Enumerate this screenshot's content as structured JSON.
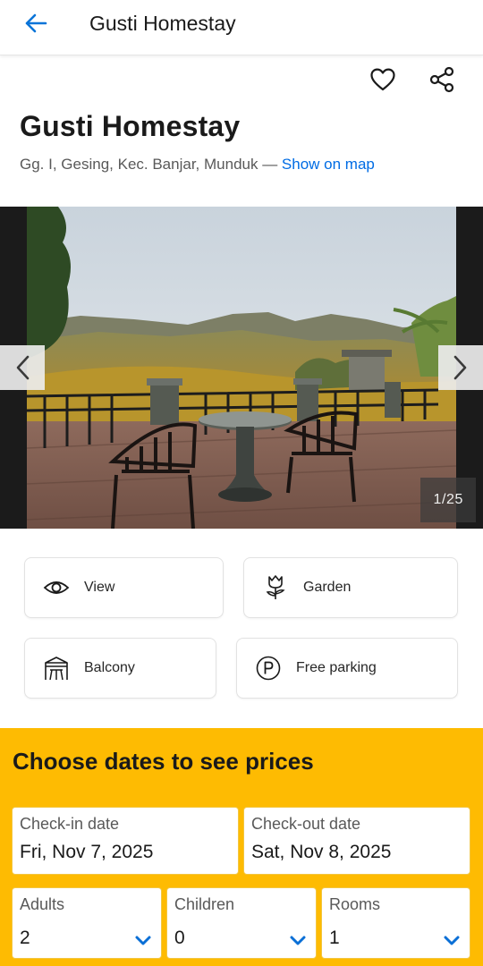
{
  "header": {
    "title": "Gusti Homestay",
    "back_icon": "arrow-left-icon"
  },
  "actions": {
    "favorite_icon": "heart-icon",
    "share_icon": "share-icon"
  },
  "property": {
    "name": "Gusti Homestay",
    "address": "Gg. I, Gesing, Kec. Banjar, Munduk — ",
    "map_link": "Show on map"
  },
  "gallery": {
    "counter": "1/25",
    "prev_icon": "chevron-left-icon",
    "next_icon": "chevron-right-icon"
  },
  "facilities": [
    {
      "label": "View",
      "icon": "eye-icon"
    },
    {
      "label": "Garden",
      "icon": "flower-icon"
    },
    {
      "label": "Balcony",
      "icon": "balcony-icon"
    },
    {
      "label": "Free parking",
      "icon": "parking-icon"
    }
  ],
  "booking": {
    "heading": "Choose dates to see prices",
    "checkin": {
      "label": "Check-in date",
      "value": "Fri, Nov 7, 2025"
    },
    "checkout": {
      "label": "Check-out date",
      "value": "Sat, Nov 8, 2025"
    },
    "adults": {
      "label": "Adults",
      "value": "2"
    },
    "children": {
      "label": "Children",
      "value": "0"
    },
    "rooms": {
      "label": "Rooms",
      "value": "1"
    }
  },
  "colors": {
    "accent_blue": "#006ce4",
    "booking_yellow": "#febb02",
    "chevron_blue": "#006ce4"
  }
}
